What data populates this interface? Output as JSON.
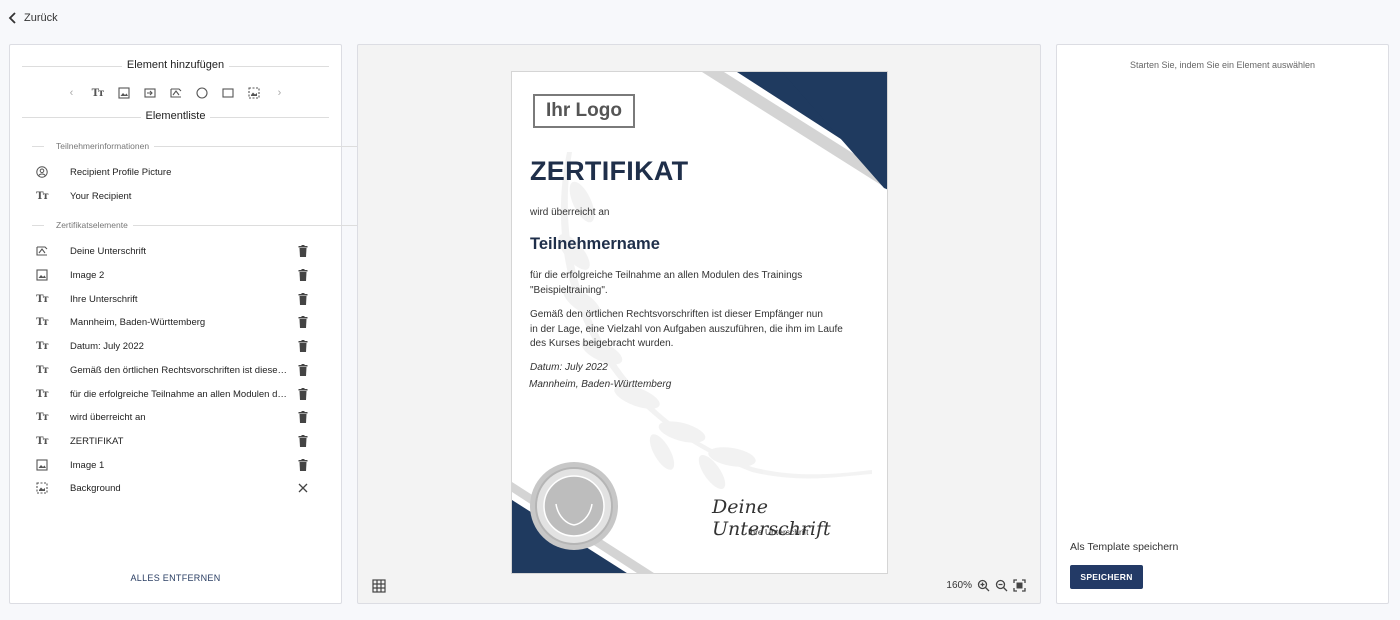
{
  "nav": {
    "back_label": "Zurück"
  },
  "left_panel": {
    "add_element_title": "Element hinzufügen",
    "toolbar_icons": [
      "chevron-left-icon",
      "text-icon",
      "image-icon",
      "field-icon",
      "signature-icon",
      "circle-icon",
      "rectangle-icon",
      "background-icon",
      "chevron-right-icon"
    ],
    "element_list_title": "Elementliste",
    "participant_section": "Teilnehmerinformationen",
    "participant_items": [
      {
        "icon": "user-circle-icon",
        "label": "Recipient Profile Picture"
      },
      {
        "icon": "text-icon",
        "label": "Your Recipient"
      }
    ],
    "cert_section": "Zertifikatselemente",
    "cert_items": [
      {
        "icon": "signature-icon",
        "label": "Deine Unterschrift",
        "action": "delete"
      },
      {
        "icon": "image-icon",
        "label": "Image 2",
        "action": "delete"
      },
      {
        "icon": "text-icon",
        "label": "Ihre Unterschrift",
        "action": "delete"
      },
      {
        "icon": "text-icon",
        "label": "Mannheim, Baden-Württemberg",
        "action": "delete"
      },
      {
        "icon": "text-icon",
        "label": "Datum: July 2022",
        "action": "delete"
      },
      {
        "icon": "text-icon",
        "label": "Gemäß den örtlichen Rechtsvorschriften ist dieser ...",
        "action": "delete"
      },
      {
        "icon": "text-icon",
        "label": "für die erfolgreiche Teilnahme an allen Modulen de...",
        "action": "delete"
      },
      {
        "icon": "text-icon",
        "label": "wird überreicht an",
        "action": "delete"
      },
      {
        "icon": "text-icon",
        "label": "ZERTIFIKAT",
        "action": "delete"
      },
      {
        "icon": "image-icon",
        "label": "Image 1",
        "action": "delete"
      },
      {
        "icon": "background-icon",
        "label": "Background",
        "action": "close"
      }
    ],
    "remove_all_label": "ALLES ENTFERNEN"
  },
  "certificate": {
    "logo_text": "Ihr Logo",
    "title": "ZERTIFIKAT",
    "presented_to": "wird überreicht an",
    "recipient_name": "Teilnehmername",
    "paragraph1_line1": "für die erfolgreiche Teilnahme an allen Modulen des Trainings",
    "paragraph1_line2": "\"Beispieltraining\".",
    "paragraph2_line1": "Gemäß den örtlichen Rechtsvorschriften ist dieser Empfänger nun",
    "paragraph2_line2": "in der Lage, eine Vielzahl von Aufgaben auszuführen, die ihm im Laufe",
    "paragraph2_line3": "des Kurses beigebracht wurden.",
    "date": "Datum: July 2022",
    "place": "Mannheim, Baden-Württemberg",
    "signature_script": "Deine Unterschrift",
    "signature_label": "Ihre Unterschrift",
    "colors": {
      "navy": "#1f3a5f",
      "silver": "#c9c9c9"
    }
  },
  "canvas_controls": {
    "zoom_level": "160%"
  },
  "right_panel": {
    "hint": "Starten Sie, indem Sie ein Element auswählen",
    "save_template_label": "Als Template speichern",
    "save_button": "SPEICHERN"
  },
  "colors": {
    "accent": "#233a66",
    "background": "#f7f8fb"
  }
}
